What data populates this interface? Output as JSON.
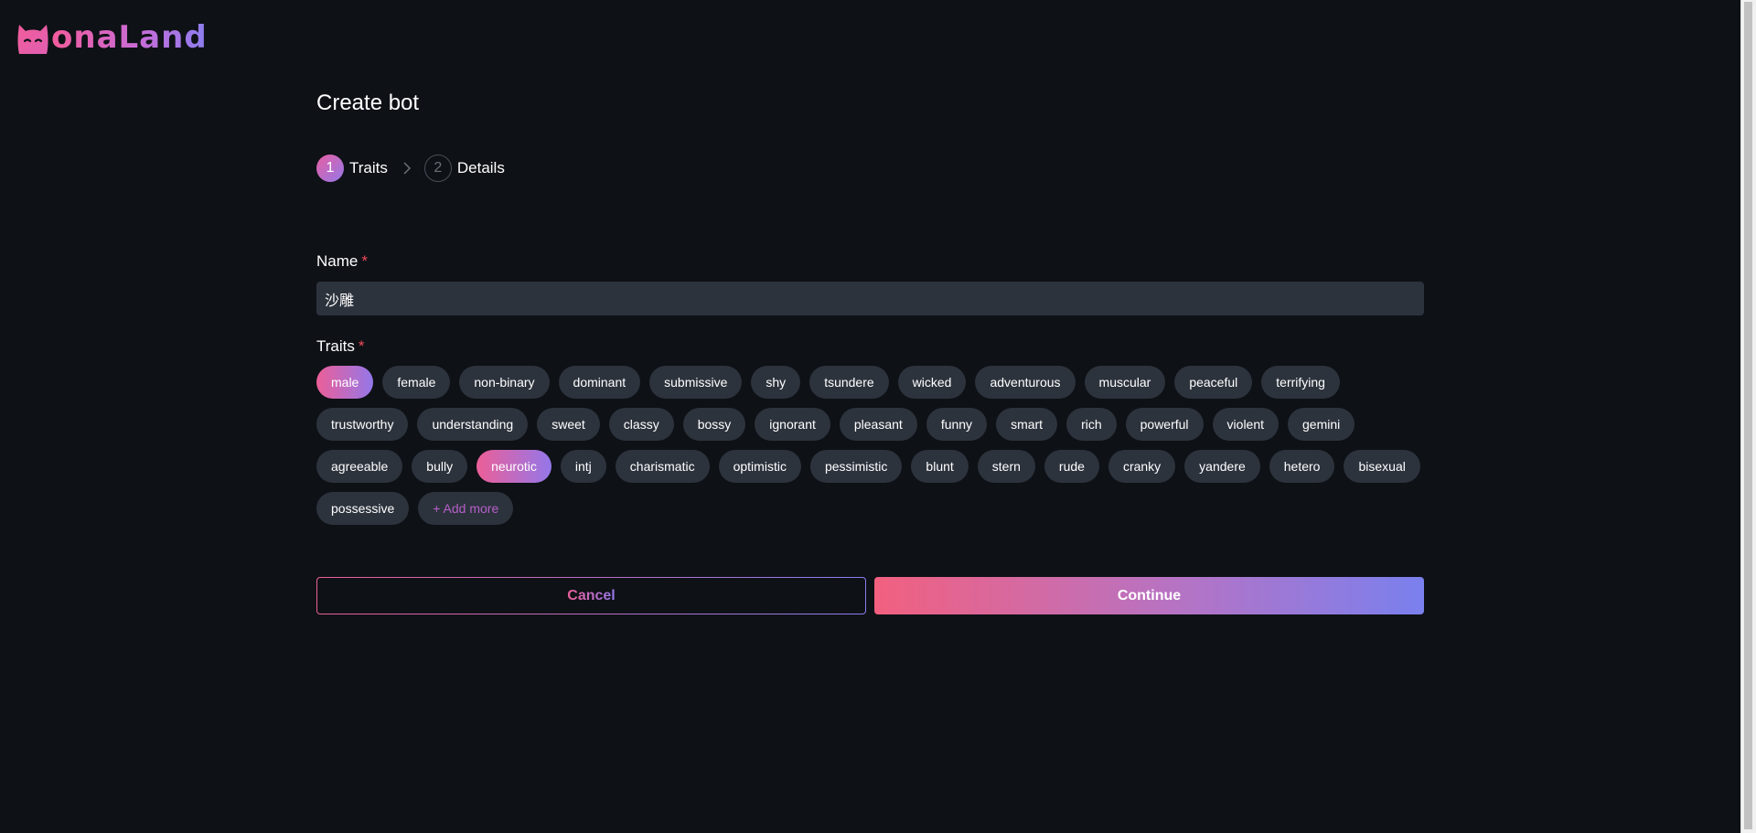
{
  "app": {
    "logo_text": "onaLand",
    "logo_icon": "cat-face-icon"
  },
  "page": {
    "title": "Create bot"
  },
  "steps": [
    {
      "number": "1",
      "label": "Traits",
      "active": true
    },
    {
      "number": "2",
      "label": "Details",
      "active": false
    }
  ],
  "form": {
    "name_label": "Name",
    "required_mark": "*",
    "name_value": "沙雕",
    "traits_label": "Traits"
  },
  "traits": [
    {
      "label": "male",
      "selected": true
    },
    {
      "label": "female",
      "selected": false
    },
    {
      "label": "non-binary",
      "selected": false
    },
    {
      "label": "dominant",
      "selected": false
    },
    {
      "label": "submissive",
      "selected": false
    },
    {
      "label": "shy",
      "selected": false
    },
    {
      "label": "tsundere",
      "selected": false
    },
    {
      "label": "wicked",
      "selected": false
    },
    {
      "label": "adventurous",
      "selected": false
    },
    {
      "label": "muscular",
      "selected": false
    },
    {
      "label": "peaceful",
      "selected": false
    },
    {
      "label": "terrifying",
      "selected": false
    },
    {
      "label": "trustworthy",
      "selected": false
    },
    {
      "label": "understanding",
      "selected": false
    },
    {
      "label": "sweet",
      "selected": false
    },
    {
      "label": "classy",
      "selected": false
    },
    {
      "label": "bossy",
      "selected": false
    },
    {
      "label": "ignorant",
      "selected": false
    },
    {
      "label": "pleasant",
      "selected": false
    },
    {
      "label": "funny",
      "selected": false
    },
    {
      "label": "smart",
      "selected": false
    },
    {
      "label": "rich",
      "selected": false
    },
    {
      "label": "powerful",
      "selected": false
    },
    {
      "label": "violent",
      "selected": false
    },
    {
      "label": "gemini",
      "selected": false
    },
    {
      "label": "agreeable",
      "selected": false
    },
    {
      "label": "bully",
      "selected": false
    },
    {
      "label": "neurotic",
      "selected": true
    },
    {
      "label": "intj",
      "selected": false
    },
    {
      "label": "charismatic",
      "selected": false
    },
    {
      "label": "optimistic",
      "selected": false
    },
    {
      "label": "pessimistic",
      "selected": false
    },
    {
      "label": "blunt",
      "selected": false
    },
    {
      "label": "stern",
      "selected": false
    },
    {
      "label": "rude",
      "selected": false
    },
    {
      "label": "cranky",
      "selected": false
    },
    {
      "label": "yandere",
      "selected": false
    },
    {
      "label": "hetero",
      "selected": false
    },
    {
      "label": "bisexual",
      "selected": false
    },
    {
      "label": "possessive",
      "selected": false
    }
  ],
  "add_more_label": "+ Add more",
  "actions": {
    "cancel_label": "Cancel",
    "continue_label": "Continue"
  },
  "colors": {
    "background": "#0e1116",
    "chip": "#2d333d",
    "accent_pink": "#ec5f98",
    "accent_purple": "#9477e9",
    "required": "#f04b5b"
  }
}
